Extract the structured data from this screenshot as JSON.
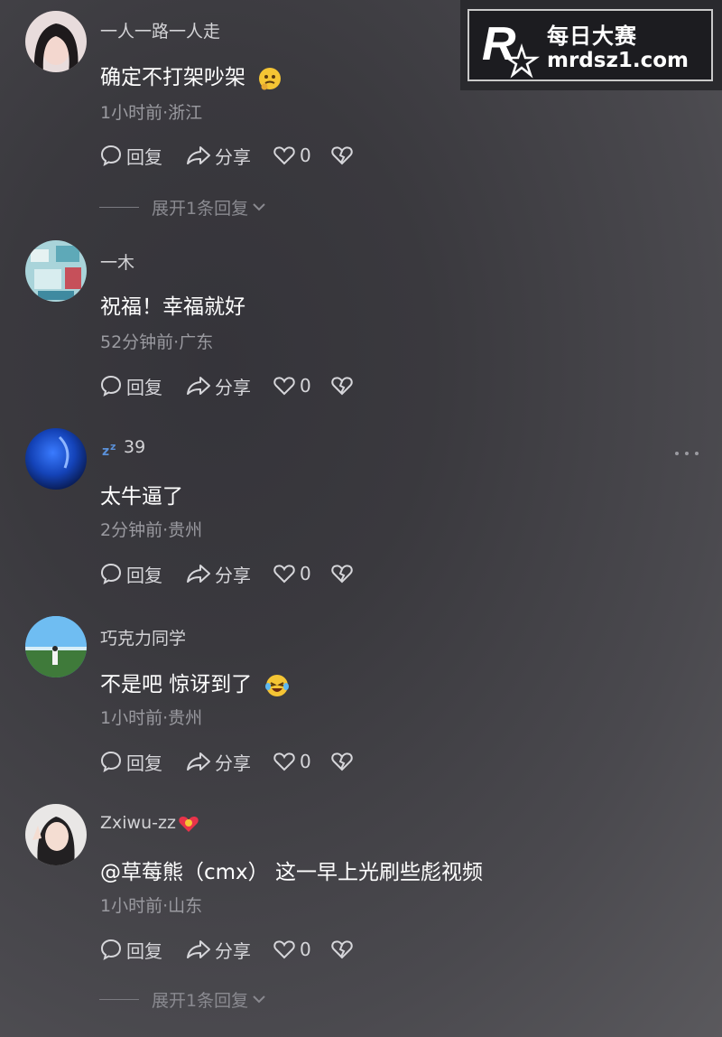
{
  "watermark": {
    "title": "每日大赛",
    "url": "mrdsz1.com",
    "logo_letter": "R",
    "logo_small": "每日大赛"
  },
  "actions": {
    "reply": "回复",
    "share": "分享"
  },
  "comments": [
    {
      "username": "一人一路一人走",
      "text": "确定不打架吵架",
      "emoji": "thinking-emoji",
      "time": "1小时前",
      "location": "浙江",
      "meta": "1小时前·浙江",
      "likes": "0",
      "expand": "展开1条回复"
    },
    {
      "username": "一木",
      "text": "祝福！幸福就好",
      "time": "52分钟前",
      "location": "广东",
      "meta": "52分钟前·广东",
      "likes": "0"
    },
    {
      "username": "39",
      "username_prefix_icon": "sleep-zz-emoji",
      "text": "太牛逼了",
      "time": "2分钟前",
      "location": "贵州",
      "meta": "2分钟前·贵州",
      "likes": "0"
    },
    {
      "username": "巧克力同学",
      "text": "不是吧 惊讶到了",
      "emoji": "laughing-tears-emoji",
      "time": "1小时前",
      "location": "贵州",
      "meta": "1小时前·贵州",
      "likes": "0"
    },
    {
      "username": "Zxiwu-zz",
      "username_badge": "heart-badge-emoji",
      "text": "@草莓熊（cmx） 这一早上光刷些彪视频",
      "time": "1小时前",
      "location": "山东",
      "meta": "1小时前·山东",
      "likes": "0",
      "expand": "展开1条回复"
    }
  ],
  "colors": {
    "background": "#3a393e",
    "text_primary": "#ffffff",
    "text_secondary": "#9a9aa0",
    "watermark_bg": "#1c1c20"
  }
}
